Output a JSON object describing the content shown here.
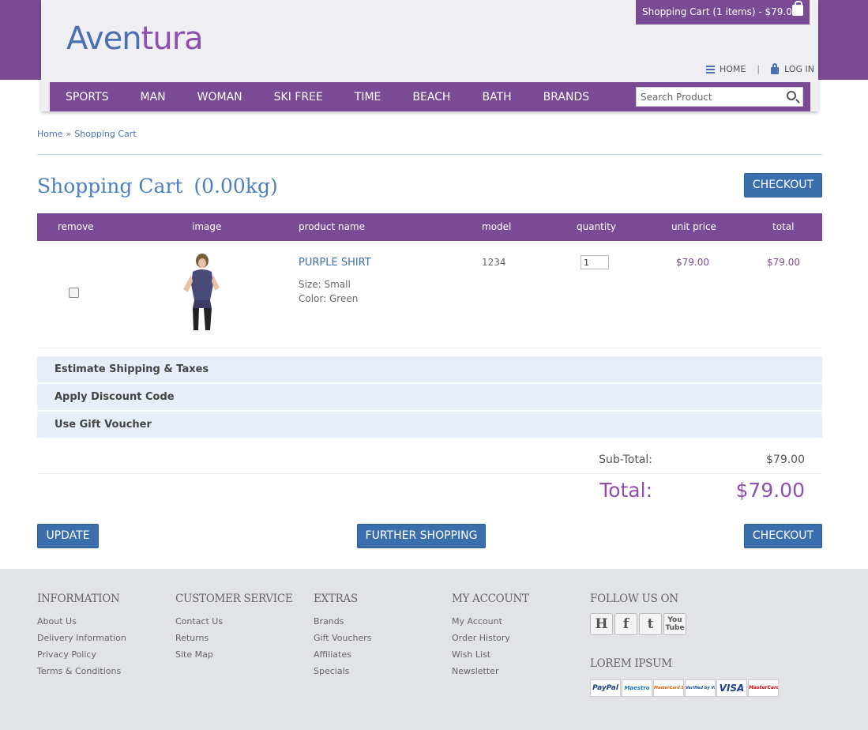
{
  "header": {
    "logo_part1": "Aven",
    "logo_part2": "tura",
    "cart_summary": "Shopping Cart (1 items) - $79.00",
    "home_label": "HOME",
    "separator": "|",
    "login_label": "LOG IN"
  },
  "nav": {
    "items": [
      "SPORTS",
      "MAN",
      "WOMAN",
      "SKI FREE",
      "TIME",
      "BEACH",
      "BATH",
      "BRANDS"
    ],
    "search_placeholder": "Search Product"
  },
  "breadcrumb": {
    "home": "Home",
    "separator": "»",
    "current": "Shopping Cart"
  },
  "page": {
    "title": "Shopping Cart",
    "weight": "(0.00kg)",
    "checkout_label": "CHECKOUT"
  },
  "table": {
    "headers": [
      "remove",
      "image",
      "product name",
      "model",
      "quantity",
      "unit price",
      "total"
    ],
    "rows": [
      {
        "name": "PURPLE SHIRT",
        "option1": "Size: Small",
        "option2": "Color: Green",
        "model": "1234",
        "quantity": "1",
        "unit_price": "$79.00",
        "total": "$79.00"
      }
    ]
  },
  "accordion": [
    "Estimate Shipping & Taxes",
    "Apply Discount Code",
    "Use Gift Voucher"
  ],
  "totals": {
    "sub_label": "Sub-Total:",
    "sub_value": "$79.00",
    "total_label": "Total:",
    "total_value": "$79.00"
  },
  "actions": {
    "update": "UPDATE",
    "further": "FURTHER SHOPPING",
    "checkout": "CHECKOUT"
  },
  "footer": {
    "information": {
      "title": "INFORMATION",
      "links": [
        "About Us",
        "Delivery Information",
        "Privacy Policy",
        "Terms & Conditions"
      ]
    },
    "customer_service": {
      "title": "CUSTOMER SERVICE",
      "links": [
        "Contact Us",
        "Returns",
        "Site Map"
      ]
    },
    "extras": {
      "title": "EXTRAS",
      "links": [
        "Brands",
        "Gift Vouchers",
        "Affiliates",
        "Specials"
      ]
    },
    "my_account": {
      "title": "MY ACCOUNT",
      "links": [
        "My Account",
        "Order History",
        "Wish List",
        "Newsletter"
      ]
    },
    "follow": {
      "title": "FOLLOW US ON",
      "icons": [
        "H",
        "f",
        "t",
        "You Tube"
      ]
    },
    "lorem": {
      "title": "LOREM IPSUM",
      "payments": [
        "PayPal",
        "Maestro",
        "MasterCard SecureCode",
        "Verified by VISA",
        "VISA",
        "MasterCard"
      ]
    }
  },
  "colors": {
    "brand_purple": "#7b4a94",
    "accent_blue": "#3a6ead"
  }
}
